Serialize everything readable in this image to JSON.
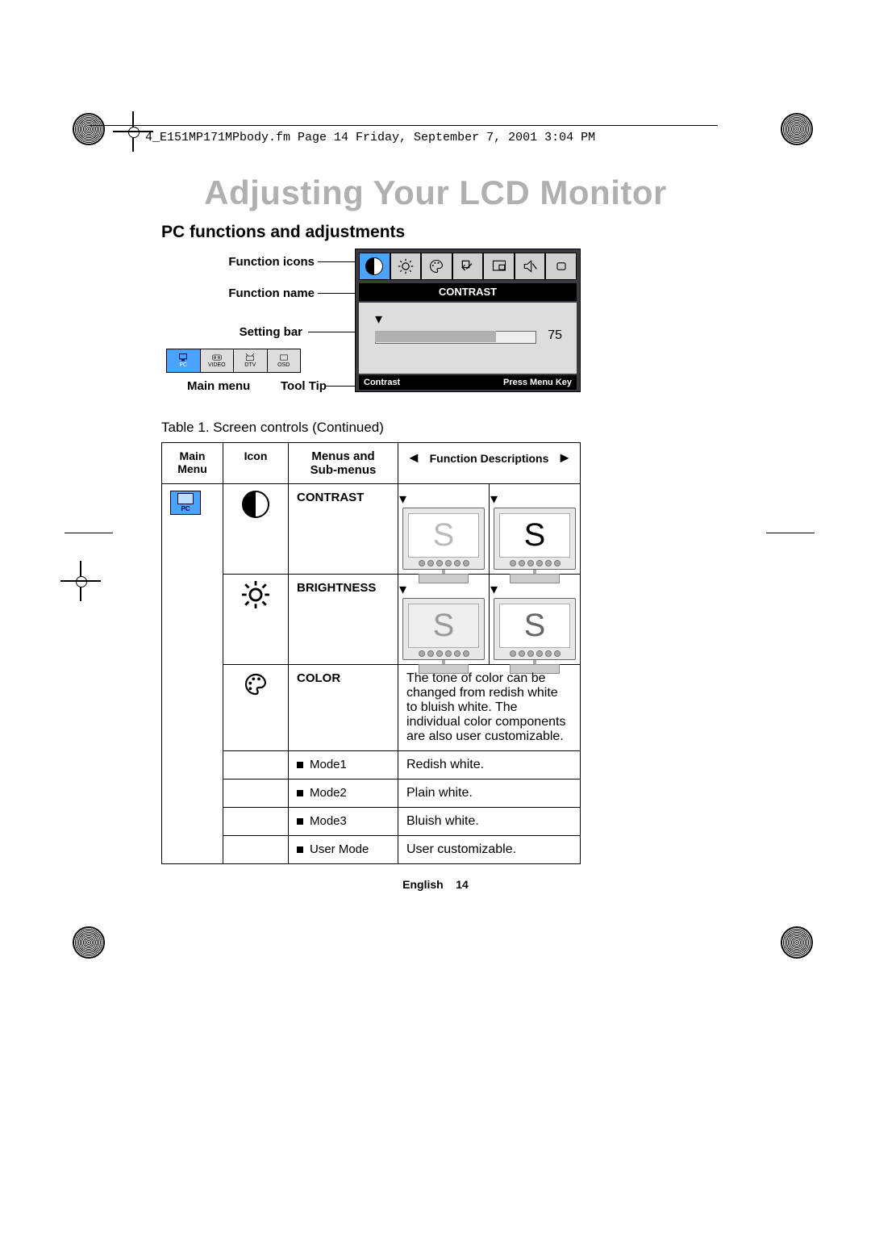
{
  "header_line": "4_E151MP171MPbody.fm  Page 14  Friday, September 7, 2001  3:04 PM",
  "title": "Adjusting Your LCD Monitor",
  "subtitle": "PC functions and adjustments",
  "labels": {
    "function_icons": "Function icons",
    "function_name": "Function name",
    "setting_bar": "Setting bar",
    "main_menu": "Main menu",
    "tool_tip": "Tool Tip"
  },
  "osd": {
    "name": "CONTRAST",
    "value": "75",
    "tooltip_left": "Contrast",
    "tooltip_right": "Press Menu Key",
    "icons": [
      "contrast",
      "brightness",
      "palette",
      "reset",
      "pip",
      "mute",
      "exit"
    ]
  },
  "mainmenu_tabs": [
    {
      "label": "PC",
      "icon": "monitor"
    },
    {
      "label": "VIDEO",
      "icon": "tape"
    },
    {
      "label": "DTV",
      "icon": "antenna"
    },
    {
      "label": "OSD",
      "icon": "box"
    }
  ],
  "table_caption": "Table 1.  Screen controls (Continued)",
  "table": {
    "headers": {
      "main_menu": "Main Menu",
      "icon": "Icon",
      "menus": "Menus and Sub-menus",
      "fd": "Function Descriptions",
      "left": "◄",
      "right": "►"
    },
    "pc_badge": "PC",
    "rows": [
      {
        "menu": "CONTRAST",
        "icon": "contrast",
        "type": "monitors"
      },
      {
        "menu": "BRIGHTNESS",
        "icon": "brightness",
        "type": "monitors"
      },
      {
        "menu": "COLOR",
        "icon": "palette",
        "type": "text",
        "desc": "The tone of color can be changed from redish white to bluish white. The individual color components are also user customizable."
      },
      {
        "menu": "Mode1",
        "bullet": true,
        "desc": "Redish white."
      },
      {
        "menu": "Mode2",
        "bullet": true,
        "desc": "Plain white."
      },
      {
        "menu": "Mode3",
        "bullet": true,
        "desc": "Bluish white."
      },
      {
        "menu": "User Mode",
        "bullet": true,
        "desc": "User customizable."
      }
    ]
  },
  "footer": {
    "lang": "English",
    "page": "14"
  }
}
